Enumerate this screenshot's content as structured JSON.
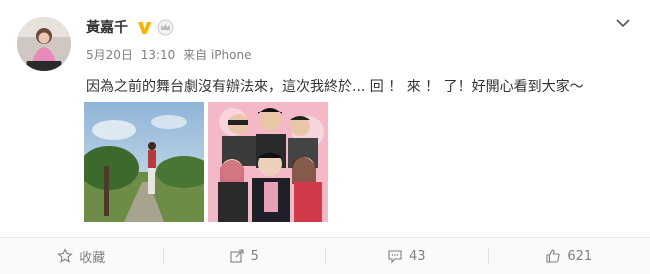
{
  "post": {
    "username": "黃嘉千",
    "date": "5月20日",
    "time": "13:10",
    "source": "来自 iPhone",
    "text": "因為之前的舞台劇沒有辦法來，這次我終於... 回 ！ 來 ！ 了！好開心看到大家～",
    "verified_icon": "verified-v-icon",
    "vip_icon": "crown-badge-icon"
  },
  "images": [
    {
      "name": "photo-outdoor-tree"
    },
    {
      "name": "photo-stage-poster"
    }
  ],
  "actions": {
    "favorite_label": "收藏",
    "repost_count": "5",
    "comment_count": "43",
    "like_count": "621"
  },
  "colors": {
    "accent": "#f7b500",
    "text": "#333333",
    "muted": "#808080"
  }
}
